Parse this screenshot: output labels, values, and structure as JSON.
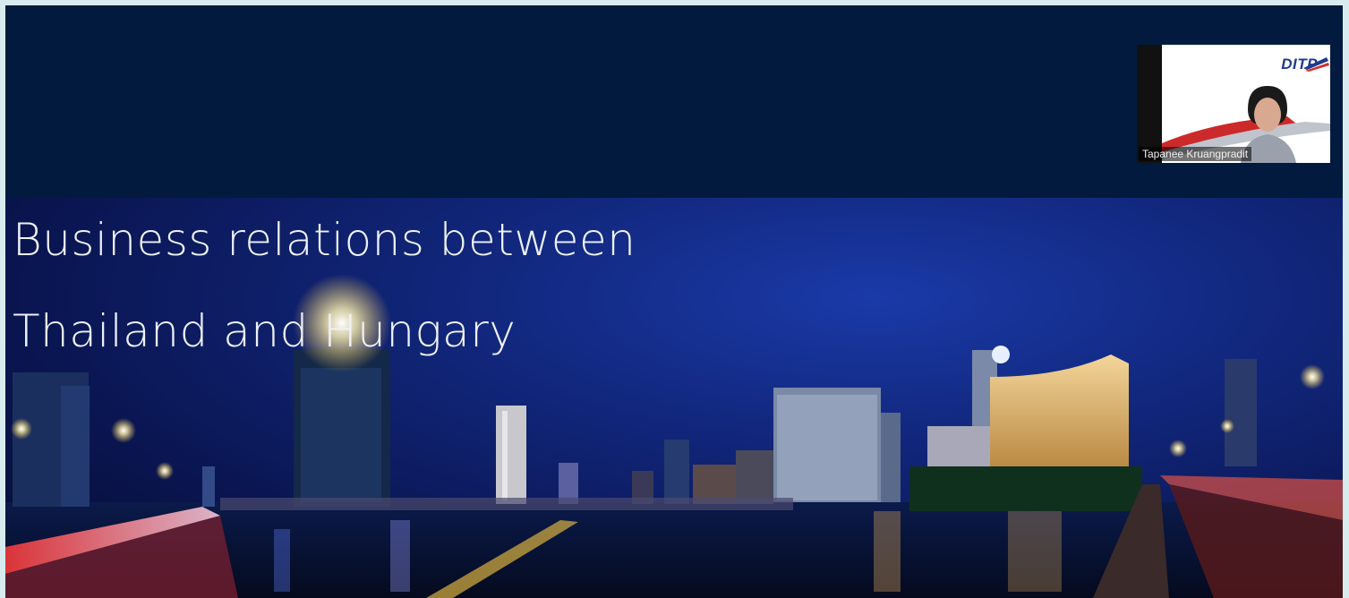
{
  "slide": {
    "title_line1": "Business relations between",
    "title_line2": "Thailand and Hungary"
  },
  "video": {
    "participant_name": "Tapanee Kruangpradit",
    "brand_text": "DITP"
  },
  "colors": {
    "header_band": "#021a3d",
    "sky": "#11267a",
    "outer_border": "#d8ecef"
  }
}
